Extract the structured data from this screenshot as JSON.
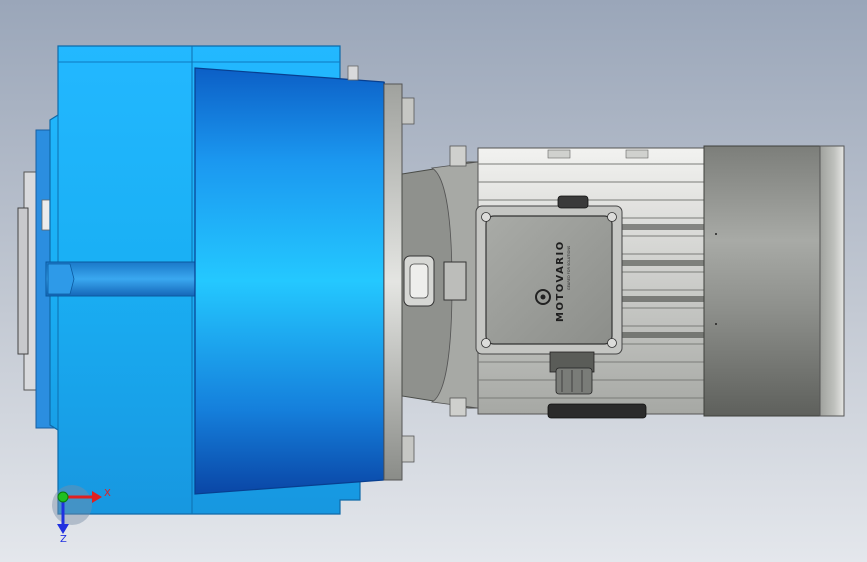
{
  "brand": {
    "name": "MOTOVARIO",
    "tagline": "GEARED FOR SOLUTIONS"
  },
  "triad": {
    "x_label": "X",
    "z_label": "Z"
  },
  "colors": {
    "gearbox_blue": "#1aa8e8",
    "gearbox_dark": "#0a55b0",
    "motor_grey": "#9a9c98",
    "axis_x": "#e02020",
    "axis_y": "#20c020",
    "axis_z": "#2030e0"
  }
}
